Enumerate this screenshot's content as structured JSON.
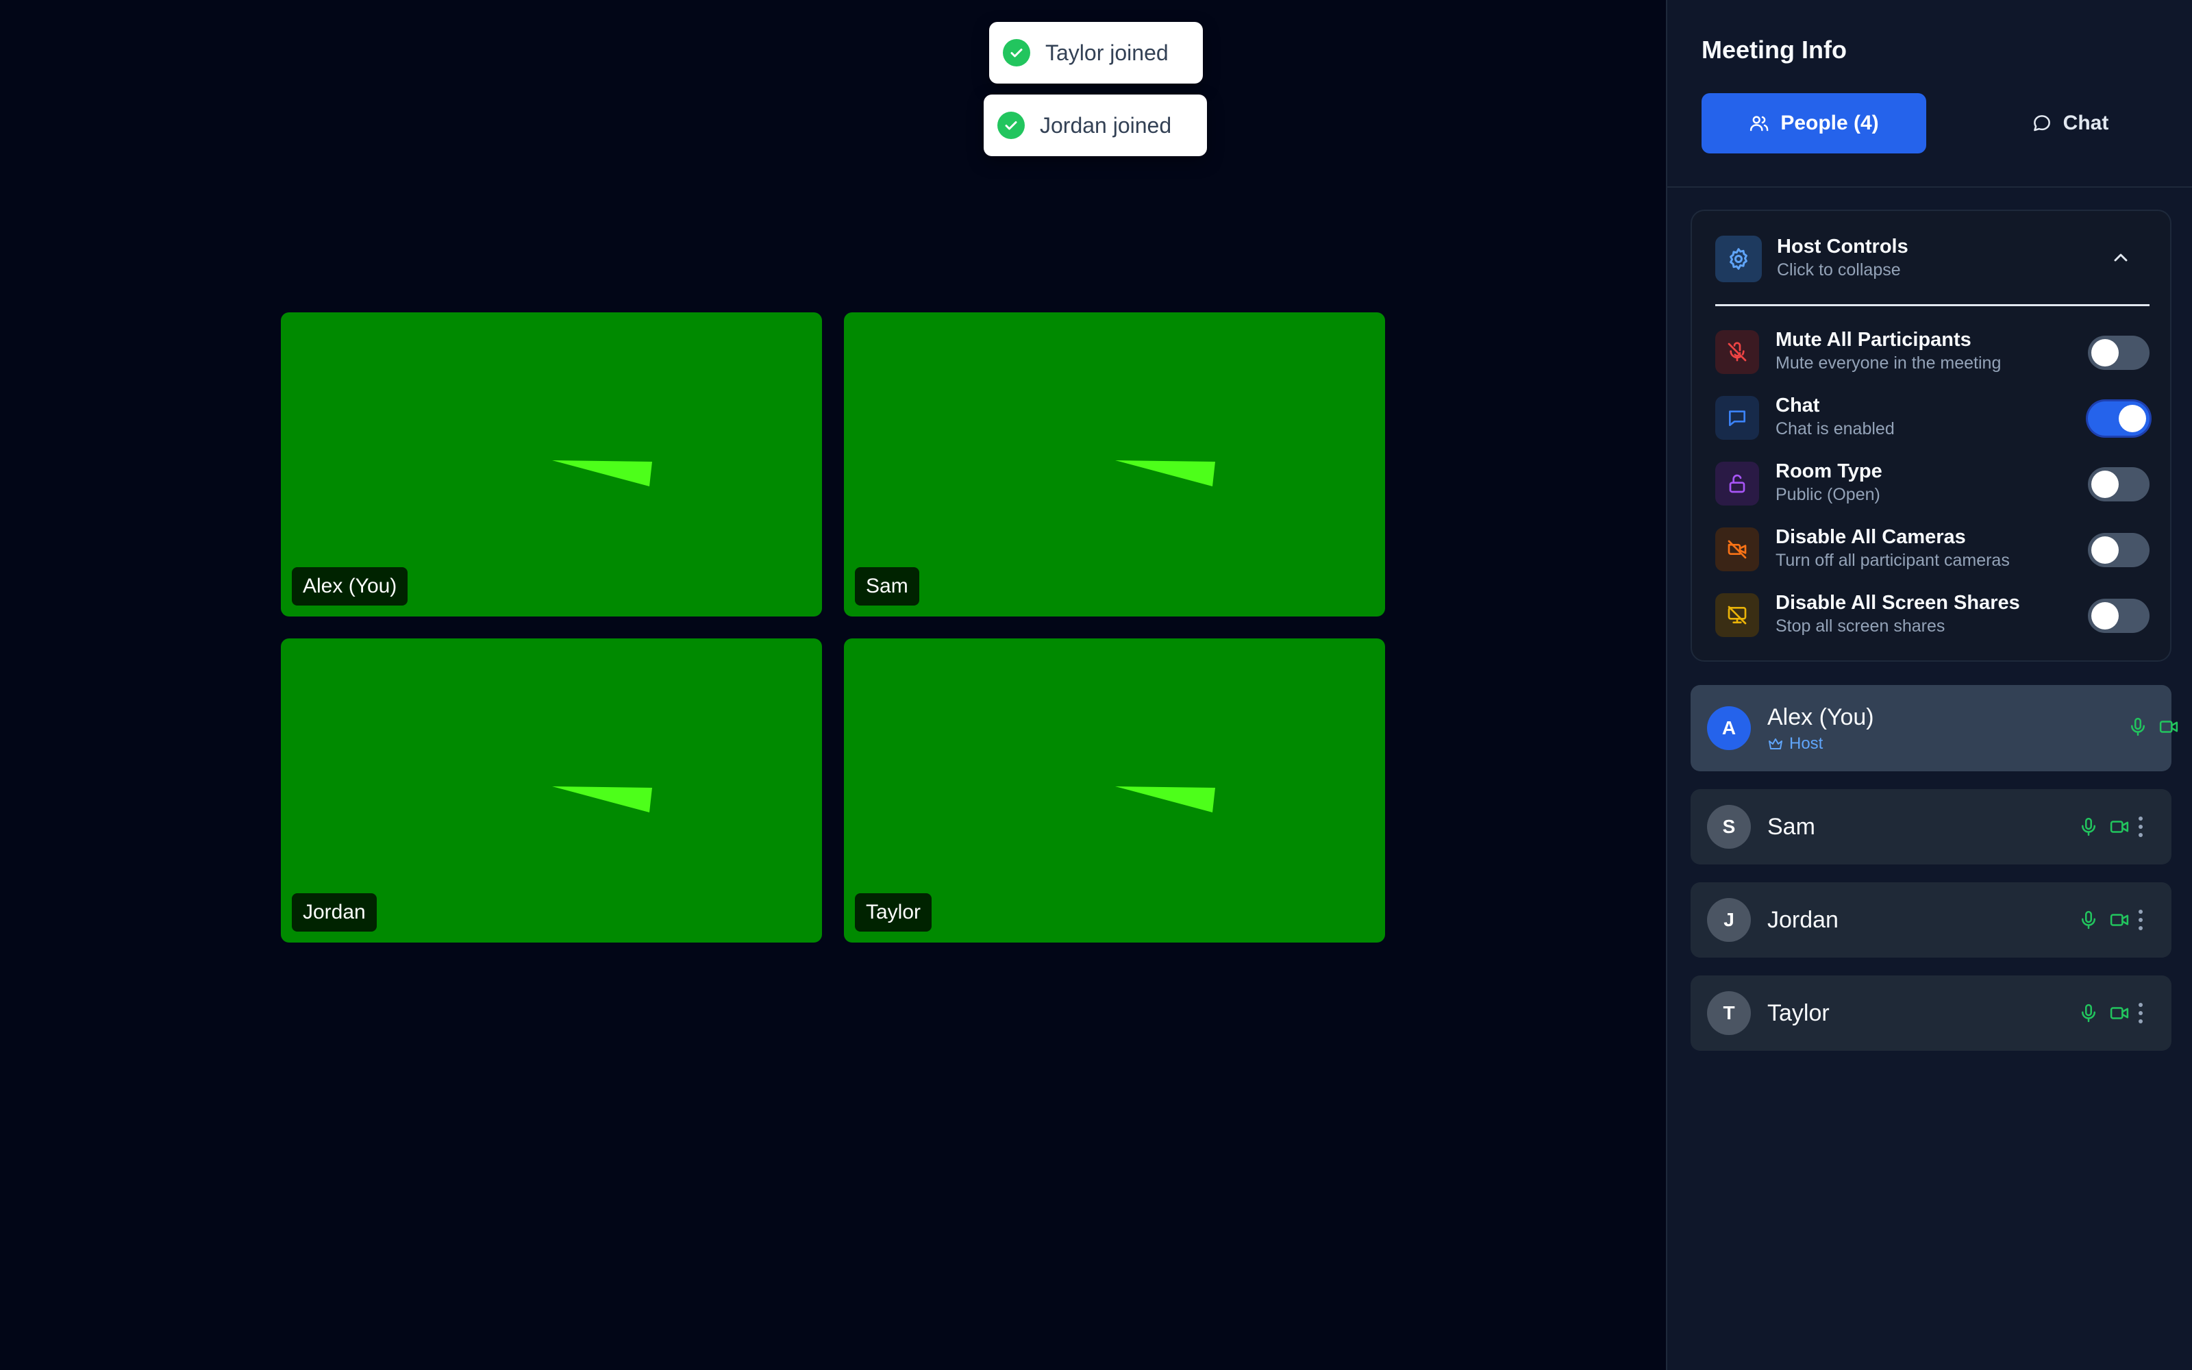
{
  "toasts": [
    {
      "text": "Taylor joined"
    },
    {
      "text": "Jordan joined"
    }
  ],
  "video_tiles": [
    {
      "name": "Alex (You)"
    },
    {
      "name": "Sam"
    },
    {
      "name": "Jordan"
    },
    {
      "name": "Taylor"
    }
  ],
  "sidebar": {
    "title": "Meeting Info",
    "tabs": {
      "people": {
        "label": "People (4)",
        "icon": "users-icon",
        "active": true
      },
      "chat": {
        "label": "Chat",
        "icon": "chat-bubble-icon",
        "active": false
      }
    },
    "host_controls": {
      "title": "Host Controls",
      "subtitle": "Click to collapse",
      "controls": [
        {
          "title": "Mute All Participants",
          "subtitle": "Mute everyone in the meeting",
          "icon": "mic-off-icon",
          "enabled": false
        },
        {
          "title": "Chat",
          "subtitle": "Chat is enabled",
          "icon": "chat-bubble-icon",
          "enabled": true
        },
        {
          "title": "Room Type",
          "subtitle": "Public (Open)",
          "icon": "unlock-icon",
          "enabled": false
        },
        {
          "title": "Disable All Cameras",
          "subtitle": "Turn off all participant cameras",
          "icon": "camera-off-icon",
          "enabled": false
        },
        {
          "title": "Disable All Screen Shares",
          "subtitle": "Stop all screen shares",
          "icon": "screen-share-off-icon",
          "enabled": false
        }
      ]
    },
    "participants": [
      {
        "initial": "A",
        "name": "Alex (You)",
        "role": "Host"
      },
      {
        "initial": "S",
        "name": "Sam"
      },
      {
        "initial": "J",
        "name": "Jordan"
      },
      {
        "initial": "T",
        "name": "Taylor"
      }
    ]
  },
  "colors": {
    "background": "#020617",
    "sidebar": "#0f172a",
    "accent": "#2563eb",
    "tile": "#008a00",
    "status_green": "#22c55e"
  }
}
